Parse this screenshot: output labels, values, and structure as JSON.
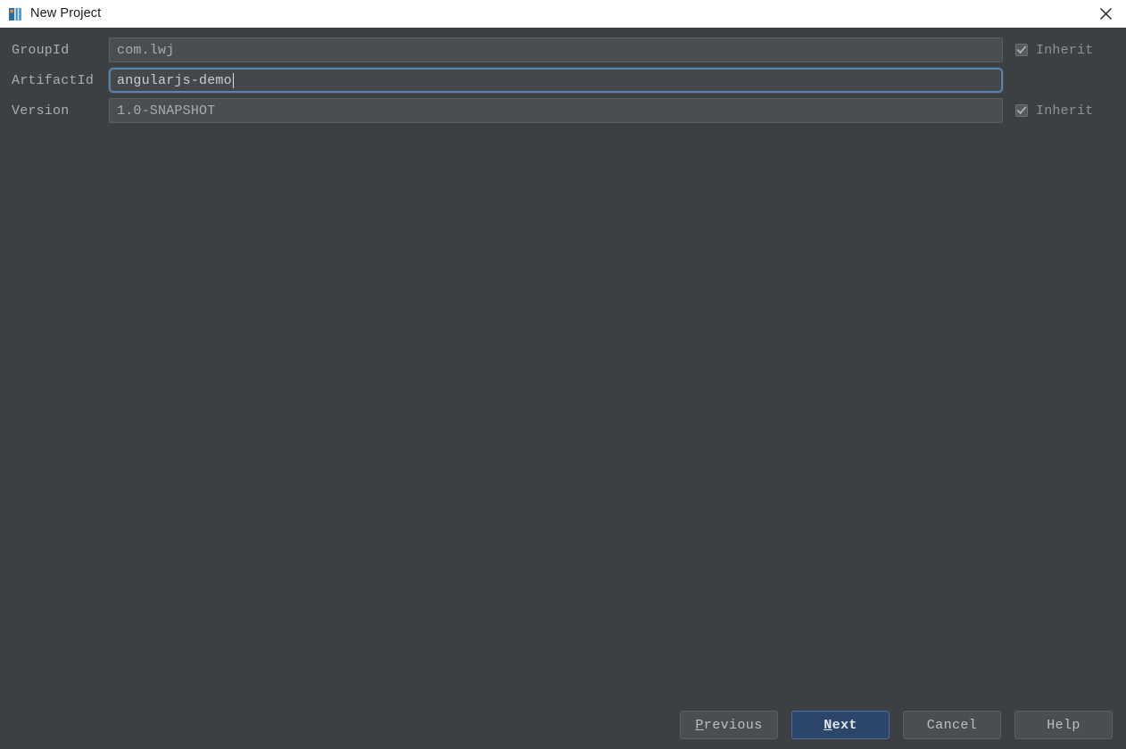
{
  "window": {
    "title": "New Project",
    "icon": "intellij-idea-logo-icon",
    "close_icon": "close-icon"
  },
  "form": {
    "rows": [
      {
        "label": "GroupId",
        "value": "com.lwj",
        "focused": false,
        "inherit_label": "Inherit",
        "inherit_checked": true,
        "inherit_enabled": false
      },
      {
        "label": "ArtifactId",
        "value": "angularjs-demo",
        "focused": true,
        "inherit_label": "",
        "inherit_checked": false,
        "inherit_enabled": false
      },
      {
        "label": "Version",
        "value": "1.0-SNAPSHOT",
        "focused": false,
        "inherit_label": "Inherit",
        "inherit_checked": true,
        "inherit_enabled": false
      }
    ]
  },
  "buttons": {
    "previous": {
      "label": "Previous",
      "mnemonic": "P",
      "default": false
    },
    "next": {
      "label": "Next",
      "mnemonic": "N",
      "default": true
    },
    "cancel": {
      "label": "Cancel",
      "mnemonic": "",
      "default": false
    },
    "help": {
      "label": "Help",
      "mnemonic": "",
      "default": false
    }
  },
  "colors": {
    "dialog_background": "#3c4043",
    "titlebar_background": "#ffffff",
    "field_background": "#4a4e50",
    "field_border": "#5d6164",
    "focus_border": "#5f83a8",
    "default_button_background": "#2c456b",
    "default_button_border": "#4a6d9c",
    "label_text": "#a9adb1",
    "disabled_text": "#8d9195"
  }
}
